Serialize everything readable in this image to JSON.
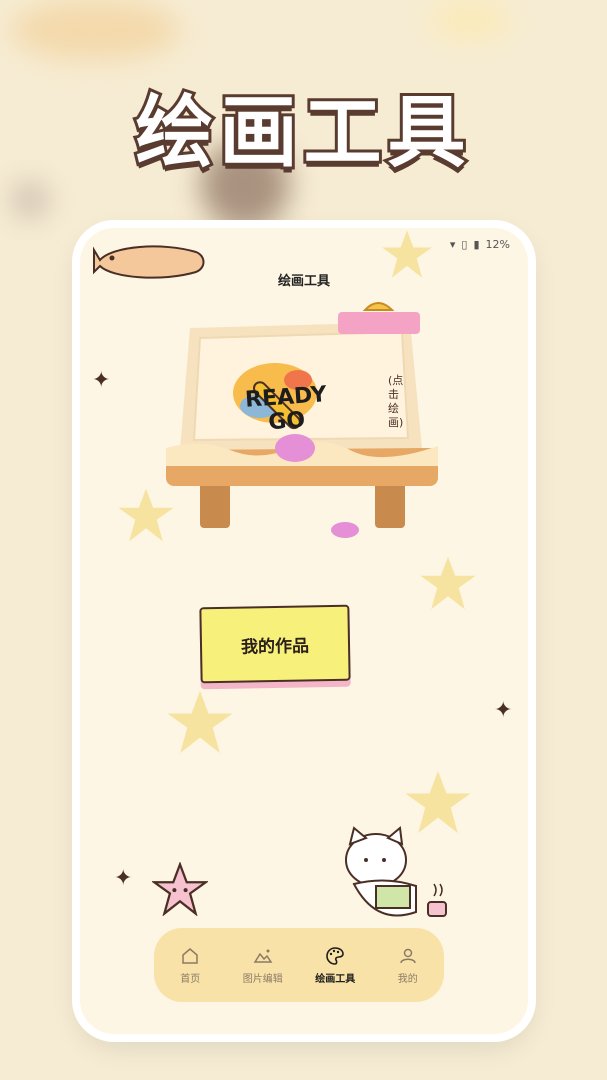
{
  "hero": {
    "title": "绘画工具"
  },
  "status_bar": {
    "battery": "12%"
  },
  "app": {
    "title": "绘画工具"
  },
  "canvas": {
    "board_text_line1": "READY",
    "board_text_line2": "GO",
    "hint": "(点击绘画)"
  },
  "my_works": {
    "label": "我的作品"
  },
  "tabs": [
    {
      "label": "首页",
      "icon": "home-icon",
      "active": false
    },
    {
      "label": "图片编辑",
      "icon": "mountain-image-icon",
      "active": false
    },
    {
      "label": "绘画工具",
      "icon": "palette-icon",
      "active": true
    },
    {
      "label": "我的",
      "icon": "user-icon",
      "active": false
    }
  ],
  "colors": {
    "accent": "#f9e2a8",
    "background": "#fdf6e4",
    "button_yellow": "#f7f07a",
    "outline": "#4a2f26"
  }
}
